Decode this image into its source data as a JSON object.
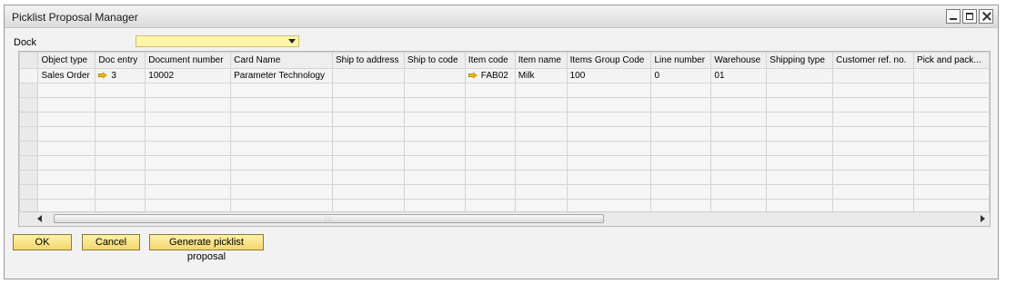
{
  "window": {
    "title": "Picklist Proposal Manager"
  },
  "filter": {
    "dock_label": "Dock",
    "dock_value": ""
  },
  "grid": {
    "columns": [
      "Object type",
      "Doc entry",
      "Document number",
      "Card Name",
      "Ship to address",
      "Ship to code",
      "Item code",
      "Item name",
      "Items Group Code",
      "Line number",
      "Warehouse",
      "Shipping type",
      "Customer ref. no.",
      "Pick and pack..."
    ],
    "rows": [
      {
        "object_type": "Sales Order",
        "doc_entry": "3",
        "document_number": "10002",
        "card_name": "Parameter Technology",
        "ship_to_address": "",
        "ship_to_code": "",
        "item_code": "FAB02",
        "item_name": "Milk",
        "items_group_code": "100",
        "line_number": "0",
        "warehouse": "01",
        "shipping_type": "",
        "customer_ref_no": "",
        "pick_and_pack": ""
      }
    ]
  },
  "scrollbar": {
    "grip": ":::"
  },
  "buttons": {
    "ok": "OK",
    "cancel": "Cancel",
    "generate": "Generate picklist proposal"
  },
  "colors": {
    "field_bg": "#fff6a8",
    "button_bg": "#f2d76e",
    "link_arrow": "#e0aa10"
  }
}
